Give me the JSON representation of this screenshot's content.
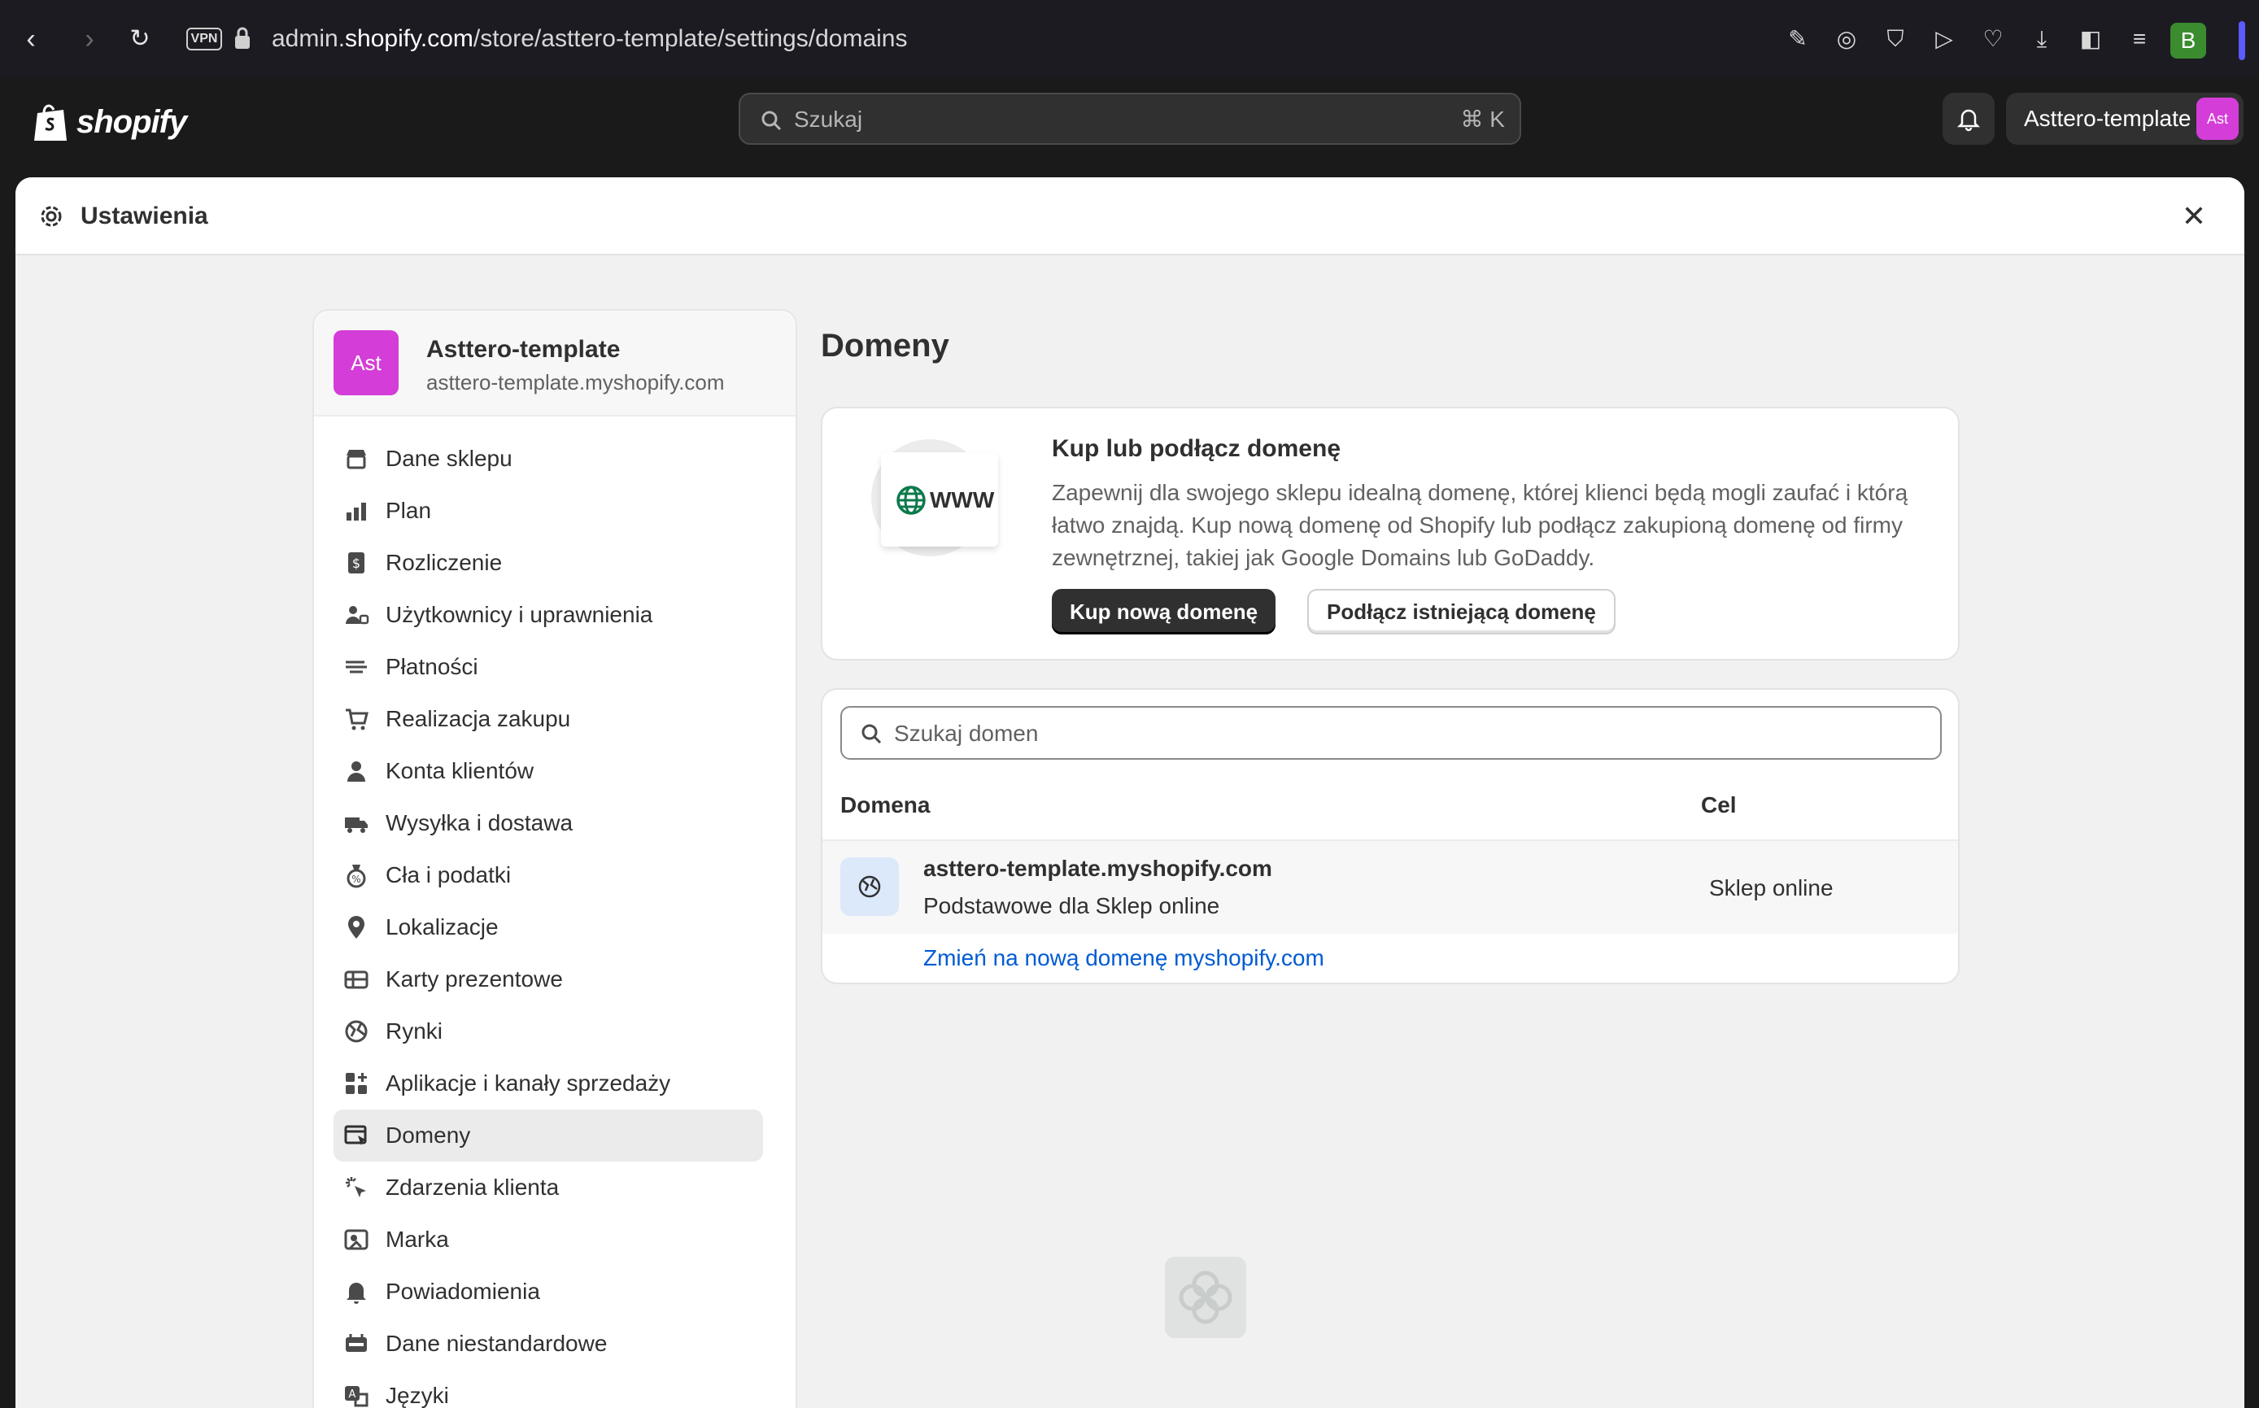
{
  "browser": {
    "url_prefix": "admin.",
    "url_domain": "shopify.com",
    "url_path": "/store/asttero-template/settings/domains",
    "vpn_label": "VPN",
    "profile_initial": "B"
  },
  "topbar": {
    "logo_text": "shopify",
    "search_placeholder": "Szukaj",
    "search_shortcut": "⌘ K",
    "store_name": "Asttero-template",
    "store_avatar": "Ast"
  },
  "modal": {
    "title": "Ustawienia",
    "close_glyph": "✕"
  },
  "sidebar": {
    "store_name": "Asttero-template",
    "store_url": "asttero-template.myshopify.com",
    "store_avatar": "Ast",
    "items": [
      {
        "label": "Dane sklepu",
        "icon": "store-icon"
      },
      {
        "label": "Plan",
        "icon": "plan-icon"
      },
      {
        "label": "Rozliczenie",
        "icon": "billing-icon"
      },
      {
        "label": "Użytkownicy i uprawnienia",
        "icon": "users-icon"
      },
      {
        "label": "Płatności",
        "icon": "payments-icon"
      },
      {
        "label": "Realizacja zakupu",
        "icon": "cart-icon"
      },
      {
        "label": "Konta klientów",
        "icon": "person-icon"
      },
      {
        "label": "Wysyłka i dostawa",
        "icon": "truck-icon"
      },
      {
        "label": "Cła i podatki",
        "icon": "tax-icon"
      },
      {
        "label": "Lokalizacje",
        "icon": "location-icon"
      },
      {
        "label": "Karty prezentowe",
        "icon": "gift-card-icon"
      },
      {
        "label": "Rynki",
        "icon": "globe-icon"
      },
      {
        "label": "Aplikacje i kanały sprzedaży",
        "icon": "apps-icon"
      },
      {
        "label": "Domeny",
        "icon": "domains-icon",
        "active": true
      },
      {
        "label": "Zdarzenia klienta",
        "icon": "cursor-icon"
      },
      {
        "label": "Marka",
        "icon": "brand-icon"
      },
      {
        "label": "Powiadomienia",
        "icon": "bell-icon"
      },
      {
        "label": "Dane niestandardowe",
        "icon": "metafields-icon"
      },
      {
        "label": "Języki",
        "icon": "language-icon"
      }
    ]
  },
  "main": {
    "page_title": "Domeny",
    "promo": {
      "badge_text": "WWW",
      "title": "Kup lub podłącz domenę",
      "description": "Zapewnij dla swojego sklepu idealną domenę, której klienci będą mogli zaufać i którą łatwo znajdą. Kup nową domenę od Shopify lub podłącz zakupioną domenę od firmy zewnętrznej, takiej jak Google Domains lub GoDaddy.",
      "primary_button": "Kup nową domenę",
      "secondary_button": "Podłącz istniejącą domenę"
    },
    "domains": {
      "search_placeholder": "Szukaj domen",
      "columns": [
        "Domena",
        "Cel"
      ],
      "rows": [
        {
          "name": "asttero-template.myshopify.com",
          "subtitle": "Podstawowe dla Sklep online",
          "target": "Sklep online"
        }
      ],
      "change_link": "Zmień na nową domenę myshopify.com"
    }
  },
  "colors": {
    "accent_link": "#005bd3",
    "store_avatar": "#d43dd8",
    "primary_button": "#303030"
  }
}
